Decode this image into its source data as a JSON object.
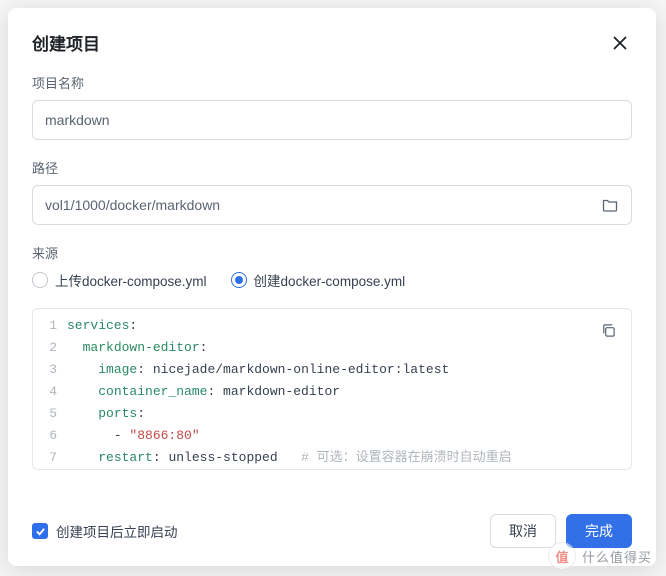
{
  "modal": {
    "title": "创建项目",
    "fields": {
      "name_label": "项目名称",
      "name_value": "markdown",
      "path_label": "路径",
      "path_value": "vol1/1000/docker/markdown",
      "source_label": "来源"
    },
    "source_options": {
      "upload": "上传docker-compose.yml",
      "create": "创建docker-compose.yml"
    },
    "code": {
      "l1_key": "services",
      "l2_key": "markdown-editor",
      "l3_key": "image",
      "l3_val": "nicejade/markdown-online-editor",
      "l3_tag": "latest",
      "l4_key": "container_name",
      "l4_val": "markdown-editor",
      "l5_key": "ports",
      "l6_val": "\"8866:80\"",
      "l7_key": "restart",
      "l7_val": "unless-stopped",
      "l7_comment": "# 可选：设置容器在崩溃时自动重启",
      "ln1": "1",
      "ln2": "2",
      "ln3": "3",
      "ln4": "4",
      "ln5": "5",
      "ln6": "6",
      "ln7": "7"
    },
    "checkbox_label": "创建项目后立即启动",
    "actions": {
      "cancel": "取消",
      "confirm": "完成"
    }
  },
  "watermark": {
    "symbol": "值",
    "text": "什么值得买"
  }
}
